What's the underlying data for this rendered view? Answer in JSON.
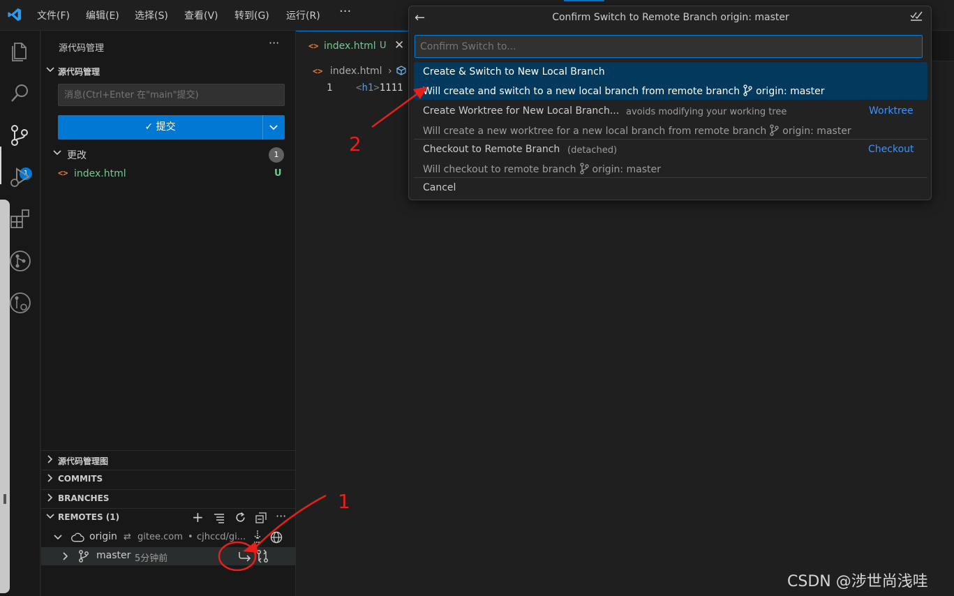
{
  "menu": [
    "文件(F)",
    "编辑(E)",
    "选择(S)",
    "查看(V)",
    "转到(G)",
    "运行(R)"
  ],
  "menu_more": "···",
  "activity": {
    "badge": "1"
  },
  "sidebar": {
    "title": "源代码管理",
    "more": "···",
    "scm_section": "源代码管理",
    "commit_placeholder": "消息(Ctrl+Enter 在\"main\"提交)",
    "commit_label": "✓ 提交",
    "changes_label": "更改",
    "changes_count": "1",
    "file_name": "index.html",
    "file_status": "U",
    "graph_section": "源代码管理图",
    "commits_section": "COMMITS",
    "branches_section": "BRANCHES",
    "remotes_section": "REMOTES (1)",
    "remotes_actions": [
      "+",
      "···"
    ],
    "origin": {
      "name": "origin",
      "host": "gitee.com",
      "path": "cjhccd/gi..."
    },
    "master": {
      "name": "master",
      "time": "5分钟前"
    }
  },
  "editor": {
    "tab_label": "index.html",
    "tab_status": "U",
    "tab_close": "✕",
    "breadcrumb_file": "index.html",
    "line_number": "1",
    "code_tag": "h1",
    "code_text": "1111"
  },
  "quickpick": {
    "title": "Confirm Switch to Remote Branch origin: master",
    "placeholder": "Confirm Switch to...",
    "items": [
      {
        "label": "Create & Switch to New Local Branch",
        "detail": "Will create and switch to a new local branch from remote branch",
        "branch": "origin: master"
      },
      {
        "label": "Create Worktree for New Local Branch...",
        "description": "avoids modifying your working tree",
        "link": "Worktree",
        "detail": "Will create a new worktree for a new local branch from remote branch",
        "branch": "origin: master"
      },
      {
        "label": "Checkout to Remote Branch",
        "description": "(detached)",
        "link": "Checkout",
        "detail": "Will checkout to remote branch",
        "branch": "origin: master"
      },
      {
        "label": "Cancel"
      }
    ]
  },
  "annotations": {
    "step1": "1",
    "step2": "2"
  },
  "watermark": "CSDN @涉世尚浅哇",
  "colors": {
    "accent": "#0078d4",
    "untracked": "#73c991",
    "annotation": "#e8201c",
    "link": "#3794ff"
  }
}
